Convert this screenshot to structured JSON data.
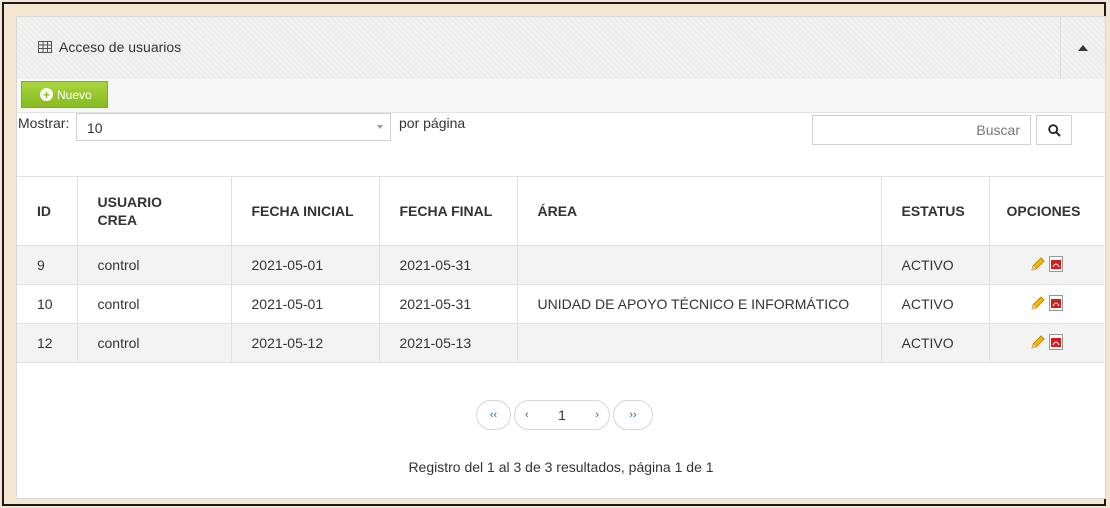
{
  "panel": {
    "title": "Acceso de usuarios",
    "header_icon": "grid-icon",
    "collapse_icon": "caret-up-icon"
  },
  "toolbar": {
    "new_label": "Nuevo",
    "new_icon": "plus-circle-icon",
    "accent": "#8cc224"
  },
  "controls": {
    "show_label": "Mostrar:",
    "page_size": "10",
    "per_page_label": "por página",
    "search_placeholder": "Buscar",
    "search_icon": "magnifier-icon"
  },
  "table": {
    "headers": [
      "ID",
      "USUARIO CREA",
      "FECHA INICIAL",
      "FECHA FINAL",
      "ÁREA",
      "ESTATUS",
      "OPCIONES"
    ],
    "rows": [
      {
        "id": "9",
        "usuario": "control",
        "fecha_inicial": "2021-05-01",
        "fecha_final": "2021-05-31",
        "area": "",
        "estatus": "ACTIVO"
      },
      {
        "id": "10",
        "usuario": "control",
        "fecha_inicial": "2021-05-01",
        "fecha_final": "2021-05-31",
        "area": "UNIDAD DE APOYO TÉCNICO E INFORMÁTICO",
        "estatus": "ACTIVO"
      },
      {
        "id": "12",
        "usuario": "control",
        "fecha_inicial": "2021-05-12",
        "fecha_final": "2021-05-13",
        "area": "",
        "estatus": "ACTIVO"
      }
    ],
    "option_icons": [
      "pencil-edit-icon",
      "pdf-icon"
    ]
  },
  "pagination": {
    "first": "‹‹",
    "prev": "‹",
    "current": "1",
    "next": "›",
    "last": "››"
  },
  "footer": {
    "records_text": "Registro del 1 al 3 de 3 resultados, página 1 de 1"
  }
}
